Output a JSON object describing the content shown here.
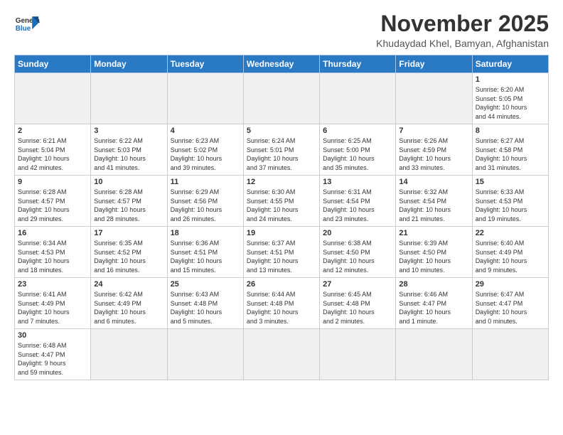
{
  "header": {
    "logo_general": "General",
    "logo_blue": "Blue",
    "month_title": "November 2025",
    "location": "Khudaydad Khel, Bamyan, Afghanistan"
  },
  "weekdays": [
    "Sunday",
    "Monday",
    "Tuesday",
    "Wednesday",
    "Thursday",
    "Friday",
    "Saturday"
  ],
  "weeks": [
    [
      {
        "day": "",
        "info": ""
      },
      {
        "day": "",
        "info": ""
      },
      {
        "day": "",
        "info": ""
      },
      {
        "day": "",
        "info": ""
      },
      {
        "day": "",
        "info": ""
      },
      {
        "day": "",
        "info": ""
      },
      {
        "day": "1",
        "info": "Sunrise: 6:20 AM\nSunset: 5:05 PM\nDaylight: 10 hours\nand 44 minutes."
      }
    ],
    [
      {
        "day": "2",
        "info": "Sunrise: 6:21 AM\nSunset: 5:04 PM\nDaylight: 10 hours\nand 42 minutes."
      },
      {
        "day": "3",
        "info": "Sunrise: 6:22 AM\nSunset: 5:03 PM\nDaylight: 10 hours\nand 41 minutes."
      },
      {
        "day": "4",
        "info": "Sunrise: 6:23 AM\nSunset: 5:02 PM\nDaylight: 10 hours\nand 39 minutes."
      },
      {
        "day": "5",
        "info": "Sunrise: 6:24 AM\nSunset: 5:01 PM\nDaylight: 10 hours\nand 37 minutes."
      },
      {
        "day": "6",
        "info": "Sunrise: 6:25 AM\nSunset: 5:00 PM\nDaylight: 10 hours\nand 35 minutes."
      },
      {
        "day": "7",
        "info": "Sunrise: 6:26 AM\nSunset: 4:59 PM\nDaylight: 10 hours\nand 33 minutes."
      },
      {
        "day": "8",
        "info": "Sunrise: 6:27 AM\nSunset: 4:58 PM\nDaylight: 10 hours\nand 31 minutes."
      }
    ],
    [
      {
        "day": "9",
        "info": "Sunrise: 6:28 AM\nSunset: 4:57 PM\nDaylight: 10 hours\nand 29 minutes."
      },
      {
        "day": "10",
        "info": "Sunrise: 6:28 AM\nSunset: 4:57 PM\nDaylight: 10 hours\nand 28 minutes."
      },
      {
        "day": "11",
        "info": "Sunrise: 6:29 AM\nSunset: 4:56 PM\nDaylight: 10 hours\nand 26 minutes."
      },
      {
        "day": "12",
        "info": "Sunrise: 6:30 AM\nSunset: 4:55 PM\nDaylight: 10 hours\nand 24 minutes."
      },
      {
        "day": "13",
        "info": "Sunrise: 6:31 AM\nSunset: 4:54 PM\nDaylight: 10 hours\nand 23 minutes."
      },
      {
        "day": "14",
        "info": "Sunrise: 6:32 AM\nSunset: 4:54 PM\nDaylight: 10 hours\nand 21 minutes."
      },
      {
        "day": "15",
        "info": "Sunrise: 6:33 AM\nSunset: 4:53 PM\nDaylight: 10 hours\nand 19 minutes."
      }
    ],
    [
      {
        "day": "16",
        "info": "Sunrise: 6:34 AM\nSunset: 4:53 PM\nDaylight: 10 hours\nand 18 minutes."
      },
      {
        "day": "17",
        "info": "Sunrise: 6:35 AM\nSunset: 4:52 PM\nDaylight: 10 hours\nand 16 minutes."
      },
      {
        "day": "18",
        "info": "Sunrise: 6:36 AM\nSunset: 4:51 PM\nDaylight: 10 hours\nand 15 minutes."
      },
      {
        "day": "19",
        "info": "Sunrise: 6:37 AM\nSunset: 4:51 PM\nDaylight: 10 hours\nand 13 minutes."
      },
      {
        "day": "20",
        "info": "Sunrise: 6:38 AM\nSunset: 4:50 PM\nDaylight: 10 hours\nand 12 minutes."
      },
      {
        "day": "21",
        "info": "Sunrise: 6:39 AM\nSunset: 4:50 PM\nDaylight: 10 hours\nand 10 minutes."
      },
      {
        "day": "22",
        "info": "Sunrise: 6:40 AM\nSunset: 4:49 PM\nDaylight: 10 hours\nand 9 minutes."
      }
    ],
    [
      {
        "day": "23",
        "info": "Sunrise: 6:41 AM\nSunset: 4:49 PM\nDaylight: 10 hours\nand 7 minutes."
      },
      {
        "day": "24",
        "info": "Sunrise: 6:42 AM\nSunset: 4:49 PM\nDaylight: 10 hours\nand 6 minutes."
      },
      {
        "day": "25",
        "info": "Sunrise: 6:43 AM\nSunset: 4:48 PM\nDaylight: 10 hours\nand 5 minutes."
      },
      {
        "day": "26",
        "info": "Sunrise: 6:44 AM\nSunset: 4:48 PM\nDaylight: 10 hours\nand 3 minutes."
      },
      {
        "day": "27",
        "info": "Sunrise: 6:45 AM\nSunset: 4:48 PM\nDaylight: 10 hours\nand 2 minutes."
      },
      {
        "day": "28",
        "info": "Sunrise: 6:46 AM\nSunset: 4:47 PM\nDaylight: 10 hours\nand 1 minute."
      },
      {
        "day": "29",
        "info": "Sunrise: 6:47 AM\nSunset: 4:47 PM\nDaylight: 10 hours\nand 0 minutes."
      }
    ],
    [
      {
        "day": "30",
        "info": "Sunrise: 6:48 AM\nSunset: 4:47 PM\nDaylight: 9 hours\nand 59 minutes."
      },
      {
        "day": "",
        "info": ""
      },
      {
        "day": "",
        "info": ""
      },
      {
        "day": "",
        "info": ""
      },
      {
        "day": "",
        "info": ""
      },
      {
        "day": "",
        "info": ""
      },
      {
        "day": "",
        "info": ""
      }
    ]
  ]
}
